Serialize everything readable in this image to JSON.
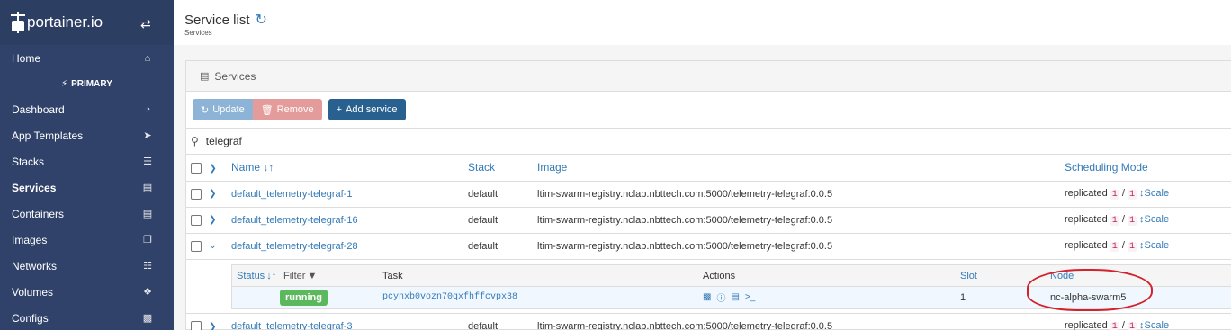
{
  "app": {
    "logo_text": "portainer.io"
  },
  "sidebar": {
    "home": "Home",
    "endpoint": "PRIMARY",
    "items": [
      {
        "label": "Dashboard",
        "icon": "tachometer-icon"
      },
      {
        "label": "App Templates",
        "icon": "rocket-icon"
      },
      {
        "label": "Stacks",
        "icon": "th-list-icon"
      },
      {
        "label": "Services",
        "icon": "list-alt-icon"
      },
      {
        "label": "Containers",
        "icon": "server-icon"
      },
      {
        "label": "Images",
        "icon": "clone-icon"
      },
      {
        "label": "Networks",
        "icon": "sitemap-icon"
      },
      {
        "label": "Volumes",
        "icon": "cubes-icon"
      },
      {
        "label": "Configs",
        "icon": "file-code-icon"
      }
    ]
  },
  "header": {
    "title": "Service list",
    "breadcrumb": "Services"
  },
  "panel": {
    "title": "Services",
    "update_label": "Update",
    "remove_label": "Remove",
    "add_label": "Add service",
    "search_value": "telegraf"
  },
  "table": {
    "headers": {
      "name": "Name",
      "stack": "Stack",
      "image": "Image",
      "scheduling": "Scheduling Mode"
    },
    "rows": [
      {
        "name": "default_telemetry-telegraf-1",
        "stack": "default",
        "image": "ltim-swarm-registry.nclab.nbttech.com:5000/telemetry-telegraf:0.0.5",
        "mode": "replicated",
        "running": "1",
        "sep": "/",
        "desired": "1",
        "scale": "Scale"
      },
      {
        "name": "default_telemetry-telegraf-16",
        "stack": "default",
        "image": "ltim-swarm-registry.nclab.nbttech.com:5000/telemetry-telegraf:0.0.5",
        "mode": "replicated",
        "running": "1",
        "sep": "/",
        "desired": "1",
        "scale": "Scale"
      },
      {
        "name": "default_telemetry-telegraf-28",
        "stack": "default",
        "image": "ltim-swarm-registry.nclab.nbttech.com:5000/telemetry-telegraf:0.0.5",
        "mode": "replicated",
        "running": "1",
        "sep": "/",
        "desired": "1",
        "scale": "Scale"
      },
      {
        "name": "default_telemetry-telegraf-3",
        "stack": "default",
        "image": "ltim-swarm-registry.nclab.nbttech.com:5000/telemetry-telegraf:0.0.5",
        "mode": "replicated",
        "running": "1",
        "sep": "/",
        "desired": "1",
        "scale": "Scale"
      }
    ]
  },
  "tasks": {
    "headers": {
      "status": "Status",
      "filter": "Filter",
      "task": "Task",
      "actions": "Actions",
      "slot": "Slot",
      "node": "Node"
    },
    "row": {
      "status": "running",
      "task": "pcynxb0vozn70qxfhffcvpx38",
      "slot": "1",
      "node": "nc-alpha-swarm5"
    }
  },
  "colors": {
    "sidebar": "#30426a",
    "primary": "#337ab7",
    "running": "#5cb85c",
    "annotation": "#d4212b"
  }
}
